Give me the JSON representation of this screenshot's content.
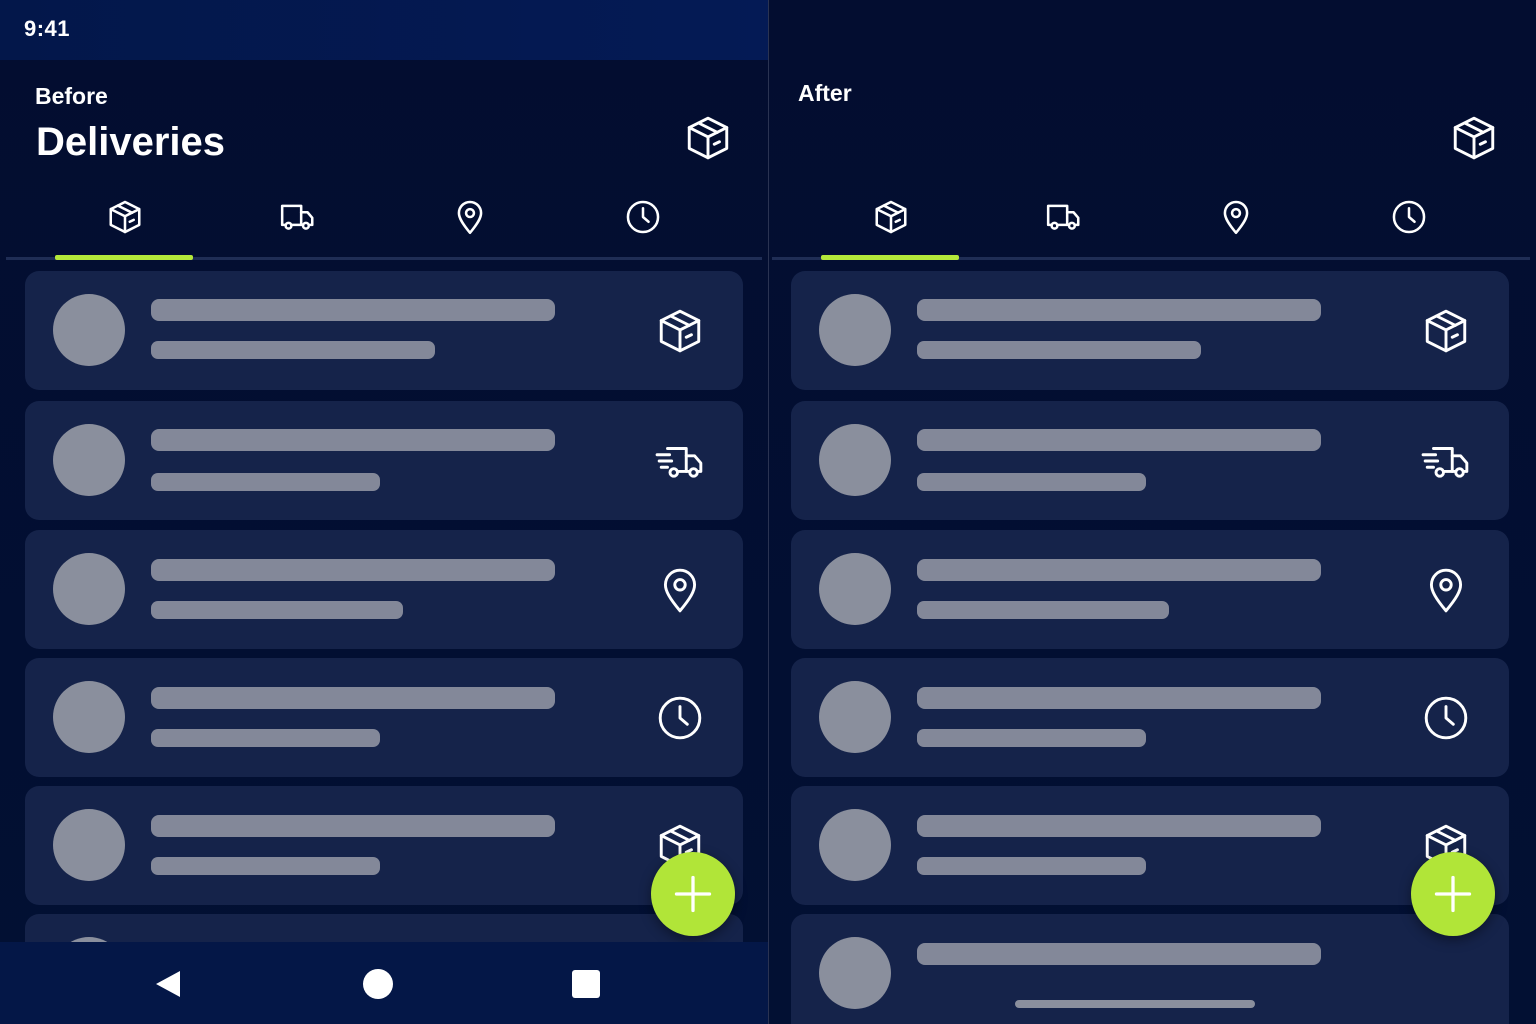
{
  "status_bar": {
    "time": "9:41"
  },
  "before": {
    "label": "Before",
    "title": "Deliveries",
    "header_icon": "package-icon",
    "tabs": [
      {
        "icon": "package-icon",
        "active": true
      },
      {
        "icon": "truck-icon",
        "active": false
      },
      {
        "icon": "location-pin-icon",
        "active": false
      },
      {
        "icon": "clock-icon",
        "active": false
      }
    ],
    "list_items": [
      {
        "status_icon": "package-icon",
        "state": "loading-placeholder"
      },
      {
        "status_icon": "fast-truck-icon",
        "state": "loading-placeholder"
      },
      {
        "status_icon": "location-pin-icon",
        "state": "loading-placeholder"
      },
      {
        "status_icon": "clock-icon",
        "state": "loading-placeholder"
      },
      {
        "status_icon": "package-icon",
        "state": "loading-placeholder"
      }
    ],
    "fab_icon": "plus-icon",
    "system_nav": [
      "back-icon",
      "home-icon",
      "recents-icon"
    ]
  },
  "after": {
    "label": "After",
    "header_icon": "package-icon",
    "tabs": [
      {
        "icon": "package-icon",
        "active": true
      },
      {
        "icon": "truck-icon",
        "active": false
      },
      {
        "icon": "location-pin-icon",
        "active": false
      },
      {
        "icon": "clock-icon",
        "active": false
      }
    ],
    "list_items": [
      {
        "status_icon": "package-icon",
        "state": "loading-placeholder"
      },
      {
        "status_icon": "fast-truck-icon",
        "state": "loading-placeholder"
      },
      {
        "status_icon": "location-pin-icon",
        "state": "loading-placeholder"
      },
      {
        "status_icon": "clock-icon",
        "state": "loading-placeholder"
      },
      {
        "status_icon": "package-icon",
        "state": "loading-placeholder"
      },
      {
        "status_icon": "",
        "state": "loading-placeholder"
      }
    ],
    "fab_icon": "plus-icon",
    "system_nav": [
      "home-indicator"
    ]
  },
  "colors": {
    "background": "#020c2a",
    "card": "#15234a",
    "skeleton": "#838899",
    "accent": "#b4e83a",
    "status_bar": "#041a55"
  }
}
